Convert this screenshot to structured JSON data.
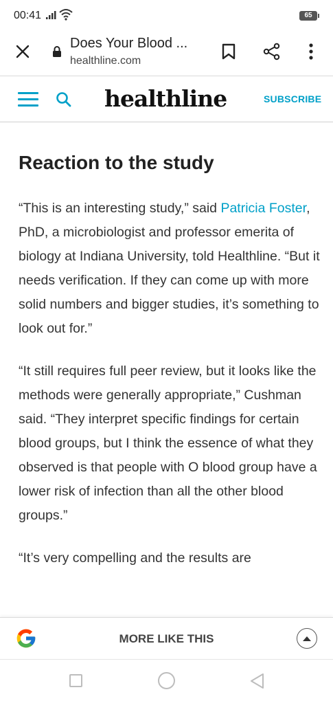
{
  "status_bar": {
    "time": "00:41",
    "battery": "65"
  },
  "browser": {
    "page_title": "Does Your Blood ...",
    "domain": "healthline.com"
  },
  "site_header": {
    "logo": "healthline",
    "subscribe": "SUBSCRIBE",
    "accent_color": "#00a0c8"
  },
  "article": {
    "heading": "Reaction to the study",
    "p1_before_link": "“This is an interesting study,” said ",
    "p1_link": "Patricia Foster",
    "p1_after_link": ", PhD, a microbiologist and professor emerita of biology at Indiana University, told Healthline. “But it needs verification. If they can come up with more solid numbers and bigger studies, it’s something to look out for.”",
    "p2": "“It still requires full peer review, but it looks like the methods were generally appropriate,” Cushman said. “They interpret specific findings for certain blood groups, but I think the essence of what they observed is that people with O blood group have a lower risk of infection than all the other blood groups.”",
    "p3": "“It’s very compelling and the results are"
  },
  "more_bar": {
    "label": "MORE LIKE THIS"
  },
  "icons": {
    "close": "close-icon",
    "lock": "lock-icon",
    "bookmark": "bookmark-icon",
    "share": "share-icon",
    "menu": "more-vert-icon",
    "hamburger": "hamburger-icon",
    "search": "search-icon",
    "google": "google-icon",
    "expand": "chevron-up-icon"
  }
}
